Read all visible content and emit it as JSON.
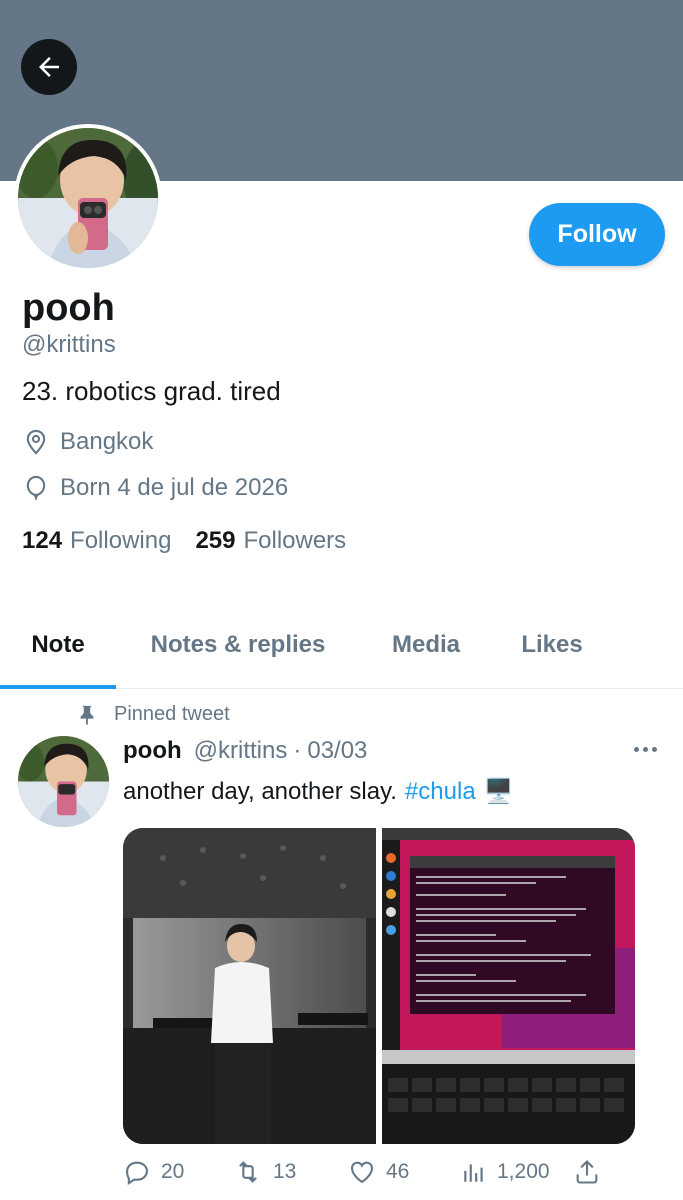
{
  "header": {
    "back_icon": "arrow-left-icon",
    "banner_color": "#657786"
  },
  "profile": {
    "name": "pooh",
    "handle": "@krittins",
    "bio": "23. robotics grad. tired",
    "location": "Bangkok",
    "location_icon": "location-pin-icon",
    "born": "Born 4 de jul de 2026",
    "born_icon": "balloon-icon",
    "following_count": "124",
    "following_label": "Following",
    "followers_count": "259",
    "followers_label": "Followers",
    "follow_label": "Follow",
    "accent_color": "#1d9bf0"
  },
  "tabs": [
    {
      "label": "Note",
      "active": true
    },
    {
      "label": "Notes & replies",
      "active": false
    },
    {
      "label": "Media",
      "active": false
    },
    {
      "label": "Likes",
      "active": false
    }
  ],
  "tweet": {
    "pinned_label": "Pinned tweet",
    "pin_icon": "pin-icon",
    "author_name": "pooh",
    "author_handle": "@krittins",
    "separator": "·",
    "date": "03/03",
    "text": "another day, another slay.",
    "hashtag": "#chula",
    "emoji": "🖥️",
    "more_icon": "more-dots-icon",
    "stats": {
      "replies": "20",
      "retweets": "13",
      "likes": "46",
      "views": "1,200"
    },
    "stat_icons": [
      "reply-icon",
      "retweet-icon",
      "heart-icon",
      "views-icon",
      "share-icon"
    ]
  }
}
